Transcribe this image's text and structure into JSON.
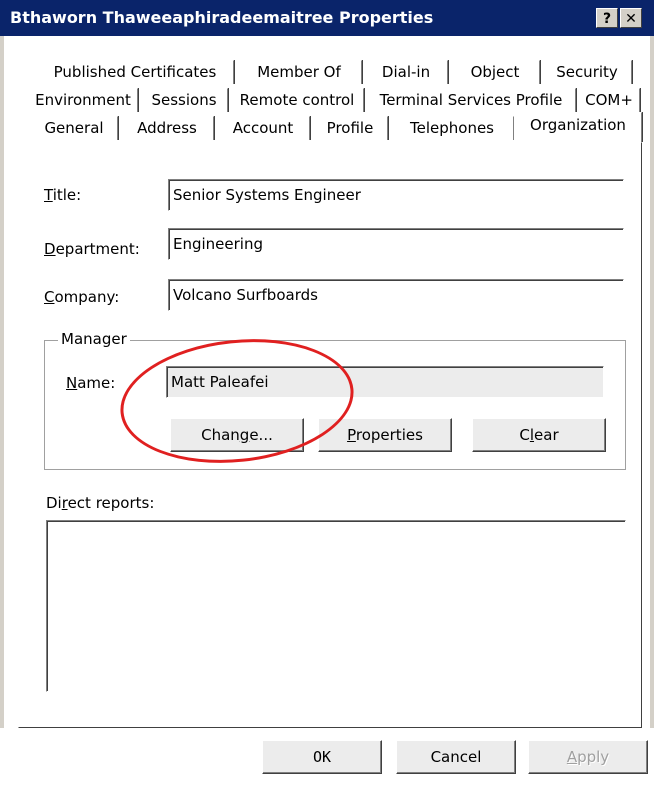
{
  "window": {
    "title": "Bthaworn Thaweeaphiradeemaitree Properties",
    "help_glyph": "?",
    "close_glyph": "✕"
  },
  "tabs": {
    "row1": [
      "Published Certificates",
      "Member Of",
      "Dial-in",
      "Object",
      "Security"
    ],
    "row2": [
      "Environment",
      "Sessions",
      "Remote control",
      "Terminal Services Profile",
      "COM+"
    ],
    "row3": [
      "General",
      "Address",
      "Account",
      "Profile",
      "Telephones",
      "Organization"
    ],
    "active": "Organization"
  },
  "form": {
    "title_label_u": "T",
    "title_label_rest": "itle:",
    "title_value": "Senior Systems Engineer",
    "department_label_u": "D",
    "department_label_rest": "epartment:",
    "department_value": "Engineering",
    "company_label_u": "C",
    "company_label_rest": "ompany:",
    "company_value": "Volcano Surfboards"
  },
  "manager": {
    "group_label": "Manager",
    "name_label_u": "N",
    "name_label_rest": "ame:",
    "name_value": "Matt Paleafei",
    "change_pre": "Chan",
    "change_u": "g",
    "change_post": "e...",
    "properties_u": "P",
    "properties_rest": "roperties",
    "clear_pre": "C",
    "clear_u": "l",
    "clear_post": "ear"
  },
  "direct_reports": {
    "label_pre": "Di",
    "label_u": "r",
    "label_post": "ect reports:",
    "items": []
  },
  "footer": {
    "ok_label": "OK",
    "cancel_label": "Cancel",
    "apply_u": "A",
    "apply_rest": "pply"
  },
  "colors": {
    "titlebar": "#0a246a",
    "annotation_circle": "#e02020"
  }
}
